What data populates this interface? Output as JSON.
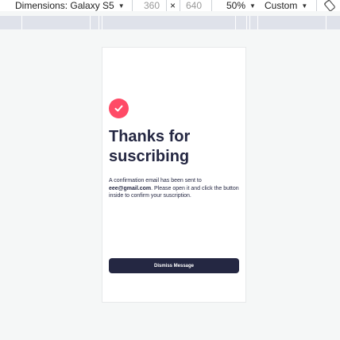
{
  "toolbar": {
    "dimensions_label": "Dimensions: Galaxy S5",
    "width_value": "360",
    "times": "×",
    "height_value": "640",
    "zoom_value": "50%",
    "throttle_value": "Custom"
  },
  "card": {
    "title": "Thanks for suscribing",
    "message_prefix": "A confirmation email has been sent to ",
    "email": "eee@gmail.com",
    "message_suffix": ". Please open it and click the button inside to confirm your suscription.",
    "dismiss_label": "Dismiss Message"
  },
  "colors": {
    "accent": "#ff4a66",
    "dark": "#242742"
  }
}
